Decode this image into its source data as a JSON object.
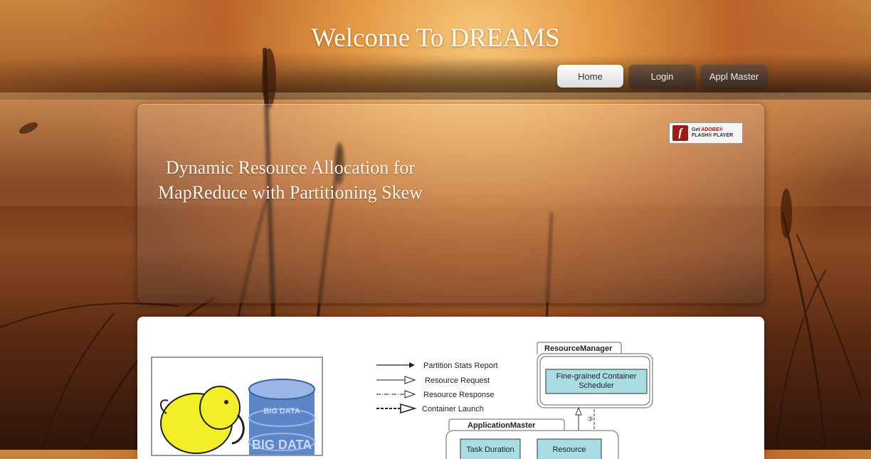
{
  "site": {
    "title": "Welcome To DREAMS"
  },
  "nav": {
    "items": [
      {
        "label": "Home",
        "active": true
      },
      {
        "label": "Login",
        "active": false
      },
      {
        "label": "Appl Master",
        "active": false
      }
    ]
  },
  "banner": {
    "title": "Dynamic Resource Allocation for MapReduce with Partitioning Skew",
    "flash_badge": {
      "line1_prefix": "Get ",
      "line1_brand": "ADOBE®",
      "line2": "FLASH® PLAYER",
      "logo_glyph": "f"
    }
  },
  "diagram": {
    "legend": [
      "Partition Stats Report",
      "Resource Request",
      "Resource Response",
      "Container Launch"
    ],
    "resource_manager": {
      "title": "ResourceManager",
      "scheduler_line1": "Fine-grained Container",
      "scheduler_line2": "Scheduler",
      "step": "③"
    },
    "application_master": {
      "title": "ApplicationMaster",
      "box1": "Task Duration",
      "box2": "Resource"
    }
  },
  "hadoop_image": {
    "db_text_1": "BIG DATA",
    "db_text_2": "BIG DATA"
  }
}
